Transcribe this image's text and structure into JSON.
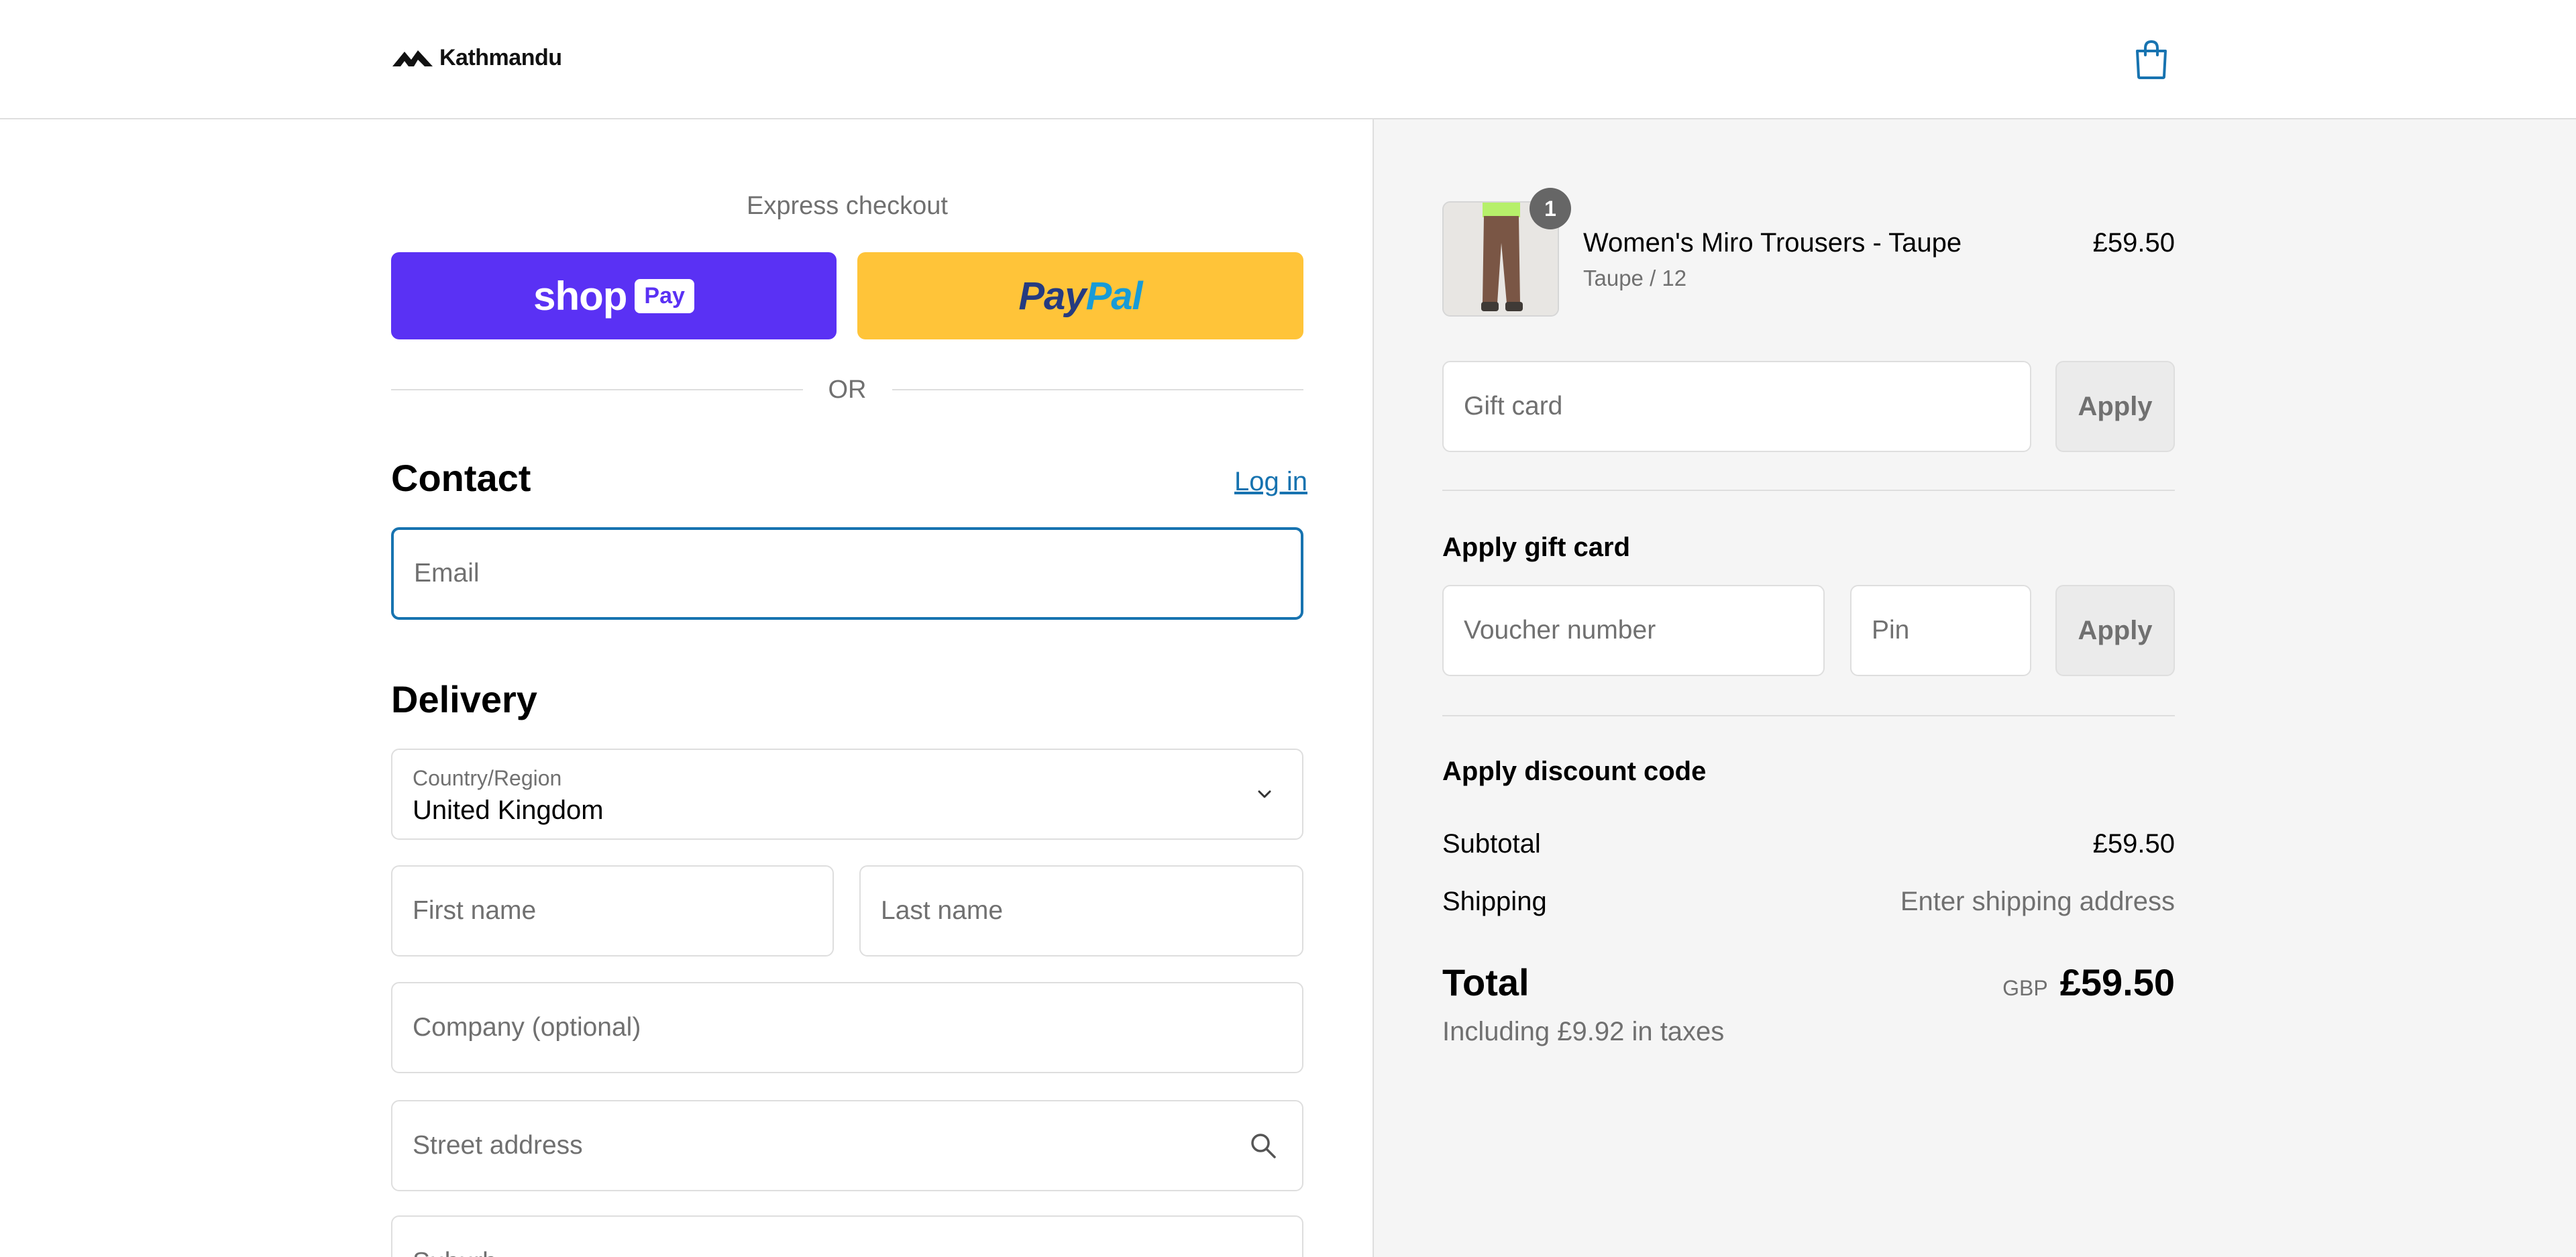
{
  "header": {
    "brand": "Kathmandu",
    "cart_icon": "shopping-bag-icon"
  },
  "colors": {
    "shop_pay": "#5a31f4",
    "paypal": "#ffc439",
    "link": "#1773b0",
    "summary_bg": "#f5f5f5"
  },
  "express": {
    "label": "Express checkout",
    "shop_word": "shop",
    "shop_badge": "Pay",
    "paypal_a": "Pay",
    "paypal_b": "Pal",
    "or": "OR"
  },
  "contact": {
    "title": "Contact",
    "login": "Log in",
    "email_placeholder": "Email"
  },
  "delivery": {
    "title": "Delivery",
    "country_label": "Country/Region",
    "country_value": "United Kingdom",
    "first_name": "First name",
    "last_name": "Last name",
    "company": "Company (optional)",
    "street": "Street address",
    "suburb": "Suburb"
  },
  "summary": {
    "item": {
      "quantity": "1",
      "name": "Women's Miro Trousers - Taupe",
      "variant": "Taupe / 12",
      "price": "£59.50"
    },
    "gift_card_placeholder": "Gift card",
    "apply": "Apply",
    "apply_gift_card_heading": "Apply gift card",
    "voucher_placeholder": "Voucher number",
    "pin_placeholder": "Pin",
    "apply_discount_heading": "Apply discount code",
    "subtotal_label": "Subtotal",
    "subtotal_value": "£59.50",
    "shipping_label": "Shipping",
    "shipping_value": "Enter shipping address",
    "total_label": "Total",
    "currency": "GBP",
    "total_value": "£59.50",
    "tax_note": "Including £9.92 in taxes"
  }
}
